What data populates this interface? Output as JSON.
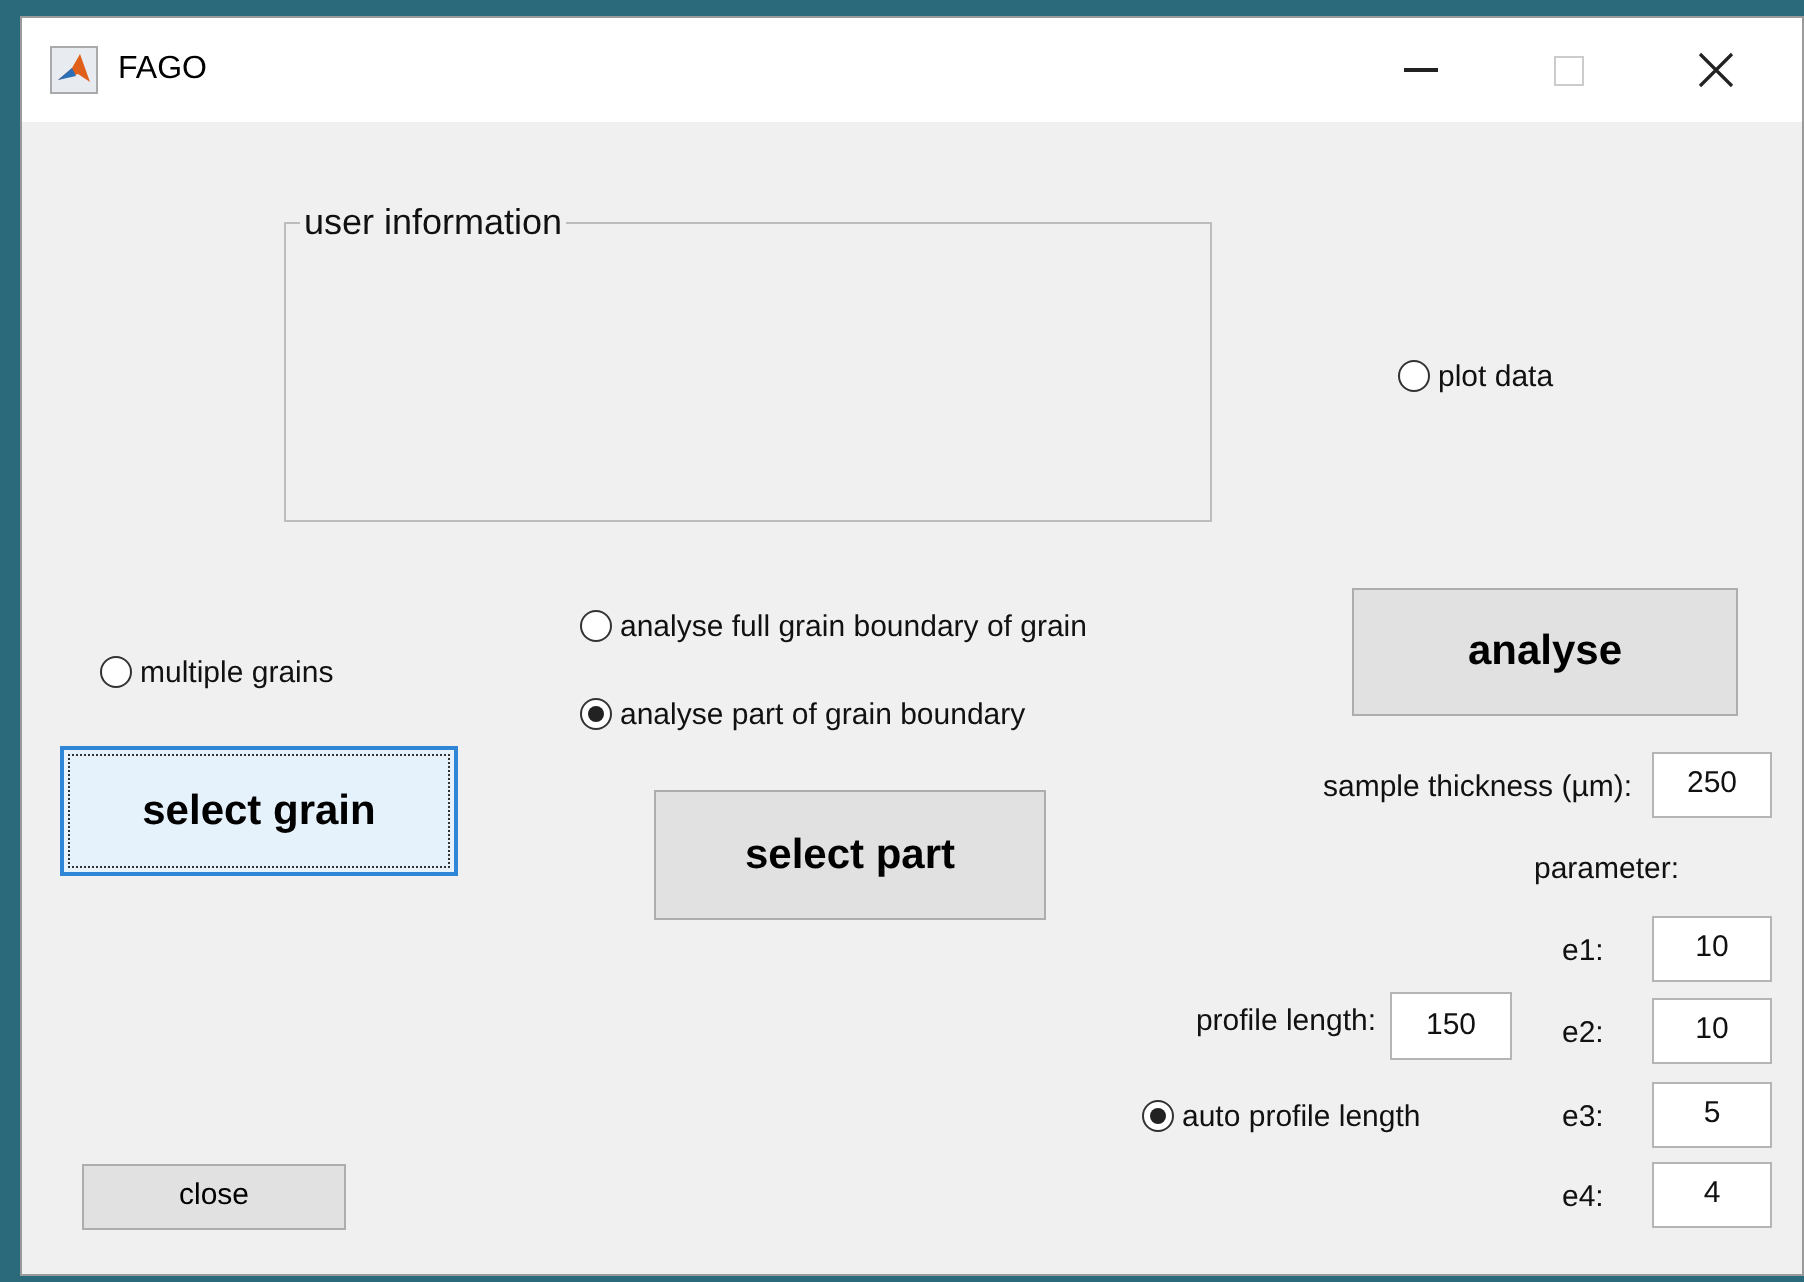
{
  "window": {
    "title": "FAGO"
  },
  "user_information": {
    "title": "user information"
  },
  "plot_data": {
    "label": "plot data",
    "selected": false
  },
  "multiple_grains": {
    "label": "multiple grains",
    "selected": false
  },
  "select_grain_button": {
    "label": "select grain",
    "focused": true
  },
  "analysis_mode": [
    {
      "label": "analyse full grain boundary of grain",
      "selected": false
    },
    {
      "label": "analyse part of grain boundary",
      "selected": true
    }
  ],
  "select_part_button": {
    "label": "select part"
  },
  "analyse_button": {
    "label": "analyse"
  },
  "sample_thickness": {
    "label": "sample thickness (µm):",
    "value": "250"
  },
  "parameter_heading": "parameter:",
  "parameters": [
    {
      "label": "e1:",
      "value": "10"
    },
    {
      "label": "e2:",
      "value": "10"
    },
    {
      "label": "e3:",
      "value": "5"
    },
    {
      "label": "e4:",
      "value": "4"
    }
  ],
  "profile_length": {
    "label": "profile length:",
    "value": "150"
  },
  "auto_profile_length": {
    "label": "auto profile length",
    "selected": true
  },
  "close_button": {
    "label": "close"
  }
}
